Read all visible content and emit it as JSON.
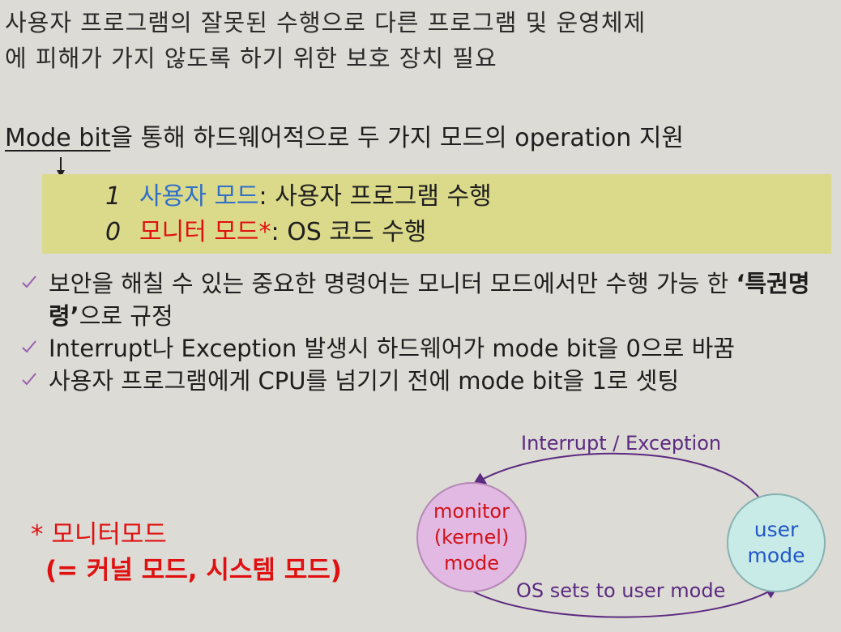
{
  "intro": {
    "line1": "사용자 프로그램의 잘못된 수행으로 다른 프로그램 및 운영체제",
    "line2": "에 피해가 가지 않도록 하기 위한 보호 장치 필요"
  },
  "mode_bit": {
    "term": "Mode bit",
    "rest": "을 통해 하드웨어적으로 두 가지 모드의 operation 지원"
  },
  "modes": [
    {
      "bit": "1",
      "label": "사용자 모드",
      "desc": ": 사용자 프로그램 수행"
    },
    {
      "bit": "0",
      "label": "모니터 모드*",
      "desc": ": OS 코드 수행"
    }
  ],
  "bullets": [
    {
      "before": "보안을 해칠 수 있는 중요한 명령어는 모니터 모드에서만 수행 가능 한 ",
      "bold": "‘특권명령’",
      "after": "으로 규정"
    },
    {
      "before": "Interrupt나 Exception 발생시 하드웨어가 mode bit을 0으로 바꿈",
      "bold": "",
      "after": ""
    },
    {
      "before": "사용자 프로그램에게 CPU를 넘기기 전에 mode bit을 1로 셋팅",
      "bold": "",
      "after": ""
    }
  ],
  "note": {
    "line1": "* 모니터모드",
    "line2": "(= 커널 모드, 시스템 모드)"
  },
  "diagram": {
    "monitor_node": {
      "line1": "monitor",
      "line2": "(kernel)",
      "line3": "mode"
    },
    "user_node": {
      "line1": "user",
      "line2": "mode"
    },
    "edge_to_monitor": "Interrupt / Exception",
    "edge_to_user": "OS sets to user mode"
  },
  "colors": {
    "background": "#dcdbd5",
    "highlight_box": "#dbd98a",
    "user_mode_text": "#2f6fc8",
    "monitor_mode_text": "#e01010",
    "check_mark": "#9b5fb0",
    "monitor_circle": "#e2b9e2",
    "user_circle": "#c9ebe7",
    "arrow": "#5c2a80"
  },
  "icons": {
    "bullet": "check-icon",
    "pointer": "down-arrow-icon"
  }
}
